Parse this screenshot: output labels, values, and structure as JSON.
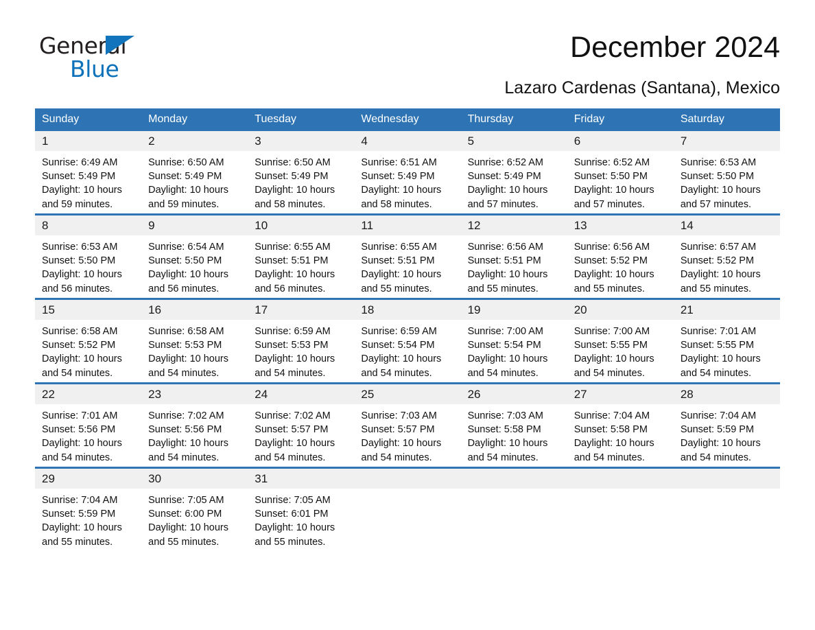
{
  "brand": {
    "name_part1": "General",
    "name_part2": "Blue",
    "triangle_color": "#1274BC",
    "blue_color": "#0D72BA"
  },
  "header": {
    "title": "December 2024",
    "subtitle": "Lazaro Cardenas (Santana), Mexico"
  },
  "theme": {
    "header_blue": "#2E74B5",
    "daynum_band": "#F0F0F0",
    "text": "#111111"
  },
  "calendar": {
    "weekday_headers": [
      "Sunday",
      "Monday",
      "Tuesday",
      "Wednesday",
      "Thursday",
      "Friday",
      "Saturday"
    ],
    "weeks": [
      [
        {
          "date": "1",
          "sunrise": "Sunrise: 6:49 AM",
          "sunset": "Sunset: 5:49 PM",
          "daylight_line1": "Daylight: 10 hours",
          "daylight_line2": "and 59 minutes."
        },
        {
          "date": "2",
          "sunrise": "Sunrise: 6:50 AM",
          "sunset": "Sunset: 5:49 PM",
          "daylight_line1": "Daylight: 10 hours",
          "daylight_line2": "and 59 minutes."
        },
        {
          "date": "3",
          "sunrise": "Sunrise: 6:50 AM",
          "sunset": "Sunset: 5:49 PM",
          "daylight_line1": "Daylight: 10 hours",
          "daylight_line2": "and 58 minutes."
        },
        {
          "date": "4",
          "sunrise": "Sunrise: 6:51 AM",
          "sunset": "Sunset: 5:49 PM",
          "daylight_line1": "Daylight: 10 hours",
          "daylight_line2": "and 58 minutes."
        },
        {
          "date": "5",
          "sunrise": "Sunrise: 6:52 AM",
          "sunset": "Sunset: 5:49 PM",
          "daylight_line1": "Daylight: 10 hours",
          "daylight_line2": "and 57 minutes."
        },
        {
          "date": "6",
          "sunrise": "Sunrise: 6:52 AM",
          "sunset": "Sunset: 5:50 PM",
          "daylight_line1": "Daylight: 10 hours",
          "daylight_line2": "and 57 minutes."
        },
        {
          "date": "7",
          "sunrise": "Sunrise: 6:53 AM",
          "sunset": "Sunset: 5:50 PM",
          "daylight_line1": "Daylight: 10 hours",
          "daylight_line2": "and 57 minutes."
        }
      ],
      [
        {
          "date": "8",
          "sunrise": "Sunrise: 6:53 AM",
          "sunset": "Sunset: 5:50 PM",
          "daylight_line1": "Daylight: 10 hours",
          "daylight_line2": "and 56 minutes."
        },
        {
          "date": "9",
          "sunrise": "Sunrise: 6:54 AM",
          "sunset": "Sunset: 5:50 PM",
          "daylight_line1": "Daylight: 10 hours",
          "daylight_line2": "and 56 minutes."
        },
        {
          "date": "10",
          "sunrise": "Sunrise: 6:55 AM",
          "sunset": "Sunset: 5:51 PM",
          "daylight_line1": "Daylight: 10 hours",
          "daylight_line2": "and 56 minutes."
        },
        {
          "date": "11",
          "sunrise": "Sunrise: 6:55 AM",
          "sunset": "Sunset: 5:51 PM",
          "daylight_line1": "Daylight: 10 hours",
          "daylight_line2": "and 55 minutes."
        },
        {
          "date": "12",
          "sunrise": "Sunrise: 6:56 AM",
          "sunset": "Sunset: 5:51 PM",
          "daylight_line1": "Daylight: 10 hours",
          "daylight_line2": "and 55 minutes."
        },
        {
          "date": "13",
          "sunrise": "Sunrise: 6:56 AM",
          "sunset": "Sunset: 5:52 PM",
          "daylight_line1": "Daylight: 10 hours",
          "daylight_line2": "and 55 minutes."
        },
        {
          "date": "14",
          "sunrise": "Sunrise: 6:57 AM",
          "sunset": "Sunset: 5:52 PM",
          "daylight_line1": "Daylight: 10 hours",
          "daylight_line2": "and 55 minutes."
        }
      ],
      [
        {
          "date": "15",
          "sunrise": "Sunrise: 6:58 AM",
          "sunset": "Sunset: 5:52 PM",
          "daylight_line1": "Daylight: 10 hours",
          "daylight_line2": "and 54 minutes."
        },
        {
          "date": "16",
          "sunrise": "Sunrise: 6:58 AM",
          "sunset": "Sunset: 5:53 PM",
          "daylight_line1": "Daylight: 10 hours",
          "daylight_line2": "and 54 minutes."
        },
        {
          "date": "17",
          "sunrise": "Sunrise: 6:59 AM",
          "sunset": "Sunset: 5:53 PM",
          "daylight_line1": "Daylight: 10 hours",
          "daylight_line2": "and 54 minutes."
        },
        {
          "date": "18",
          "sunrise": "Sunrise: 6:59 AM",
          "sunset": "Sunset: 5:54 PM",
          "daylight_line1": "Daylight: 10 hours",
          "daylight_line2": "and 54 minutes."
        },
        {
          "date": "19",
          "sunrise": "Sunrise: 7:00 AM",
          "sunset": "Sunset: 5:54 PM",
          "daylight_line1": "Daylight: 10 hours",
          "daylight_line2": "and 54 minutes."
        },
        {
          "date": "20",
          "sunrise": "Sunrise: 7:00 AM",
          "sunset": "Sunset: 5:55 PM",
          "daylight_line1": "Daylight: 10 hours",
          "daylight_line2": "and 54 minutes."
        },
        {
          "date": "21",
          "sunrise": "Sunrise: 7:01 AM",
          "sunset": "Sunset: 5:55 PM",
          "daylight_line1": "Daylight: 10 hours",
          "daylight_line2": "and 54 minutes."
        }
      ],
      [
        {
          "date": "22",
          "sunrise": "Sunrise: 7:01 AM",
          "sunset": "Sunset: 5:56 PM",
          "daylight_line1": "Daylight: 10 hours",
          "daylight_line2": "and 54 minutes."
        },
        {
          "date": "23",
          "sunrise": "Sunrise: 7:02 AM",
          "sunset": "Sunset: 5:56 PM",
          "daylight_line1": "Daylight: 10 hours",
          "daylight_line2": "and 54 minutes."
        },
        {
          "date": "24",
          "sunrise": "Sunrise: 7:02 AM",
          "sunset": "Sunset: 5:57 PM",
          "daylight_line1": "Daylight: 10 hours",
          "daylight_line2": "and 54 minutes."
        },
        {
          "date": "25",
          "sunrise": "Sunrise: 7:03 AM",
          "sunset": "Sunset: 5:57 PM",
          "daylight_line1": "Daylight: 10 hours",
          "daylight_line2": "and 54 minutes."
        },
        {
          "date": "26",
          "sunrise": "Sunrise: 7:03 AM",
          "sunset": "Sunset: 5:58 PM",
          "daylight_line1": "Daylight: 10 hours",
          "daylight_line2": "and 54 minutes."
        },
        {
          "date": "27",
          "sunrise": "Sunrise: 7:04 AM",
          "sunset": "Sunset: 5:58 PM",
          "daylight_line1": "Daylight: 10 hours",
          "daylight_line2": "and 54 minutes."
        },
        {
          "date": "28",
          "sunrise": "Sunrise: 7:04 AM",
          "sunset": "Sunset: 5:59 PM",
          "daylight_line1": "Daylight: 10 hours",
          "daylight_line2": "and 54 minutes."
        }
      ],
      [
        {
          "date": "29",
          "sunrise": "Sunrise: 7:04 AM",
          "sunset": "Sunset: 5:59 PM",
          "daylight_line1": "Daylight: 10 hours",
          "daylight_line2": "and 55 minutes."
        },
        {
          "date": "30",
          "sunrise": "Sunrise: 7:05 AM",
          "sunset": "Sunset: 6:00 PM",
          "daylight_line1": "Daylight: 10 hours",
          "daylight_line2": "and 55 minutes."
        },
        {
          "date": "31",
          "sunrise": "Sunrise: 7:05 AM",
          "sunset": "Sunset: 6:01 PM",
          "daylight_line1": "Daylight: 10 hours",
          "daylight_line2": "and 55 minutes."
        },
        {
          "date": "",
          "sunrise": "",
          "sunset": "",
          "daylight_line1": "",
          "daylight_line2": ""
        },
        {
          "date": "",
          "sunrise": "",
          "sunset": "",
          "daylight_line1": "",
          "daylight_line2": ""
        },
        {
          "date": "",
          "sunrise": "",
          "sunset": "",
          "daylight_line1": "",
          "daylight_line2": ""
        },
        {
          "date": "",
          "sunrise": "",
          "sunset": "",
          "daylight_line1": "",
          "daylight_line2": ""
        }
      ]
    ]
  }
}
